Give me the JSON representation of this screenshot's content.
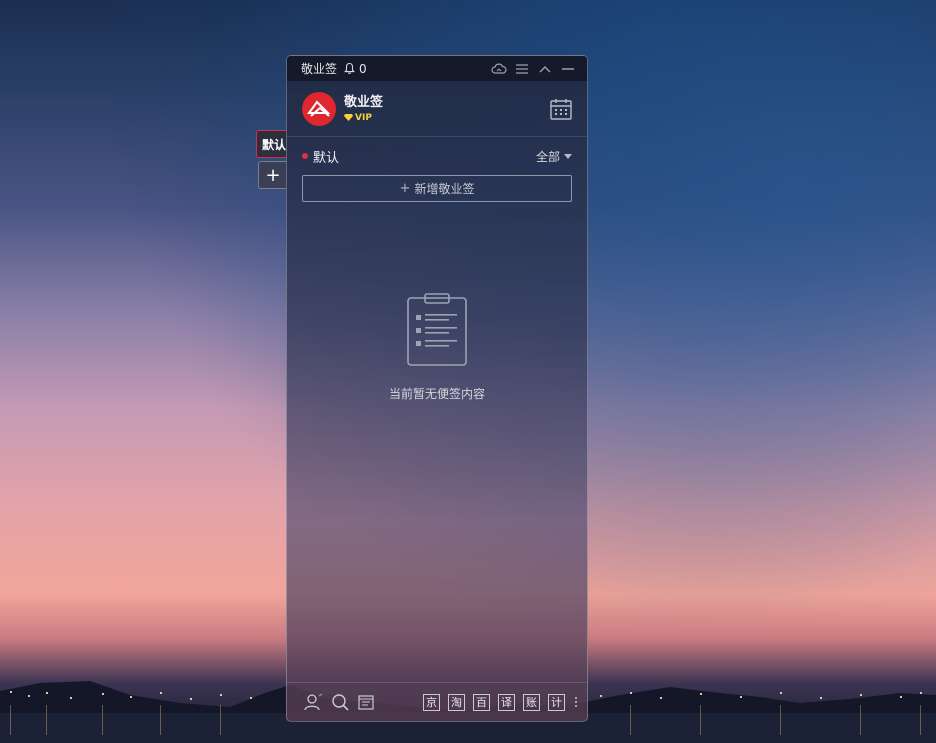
{
  "window": {
    "title": "敬业签",
    "notification_count": "0"
  },
  "user": {
    "name": "敬业签",
    "badge": "VIP"
  },
  "side_tabs": {
    "active_label": "默认",
    "add_label": "+"
  },
  "category": {
    "name": "默认",
    "filter_label": "全部"
  },
  "actions": {
    "add_note_label": "新增敬业签",
    "add_note_plus": "+"
  },
  "empty_state": {
    "message": "当前暂无便签内容"
  },
  "footer": {
    "tools": [
      "京",
      "淘",
      "百",
      "译",
      "账",
      "计"
    ]
  },
  "colors": {
    "accent_red": "#e0262f",
    "vip_gold": "#f7d13a",
    "titlebar_bg": "#141a2a"
  },
  "icons": [
    "bell-icon",
    "cloud-sync-icon",
    "menu-icon",
    "collapse-icon",
    "minimize-icon",
    "calendar-icon",
    "clipboard-icon",
    "contacts-icon",
    "search-icon",
    "calendar-small-icon"
  ]
}
